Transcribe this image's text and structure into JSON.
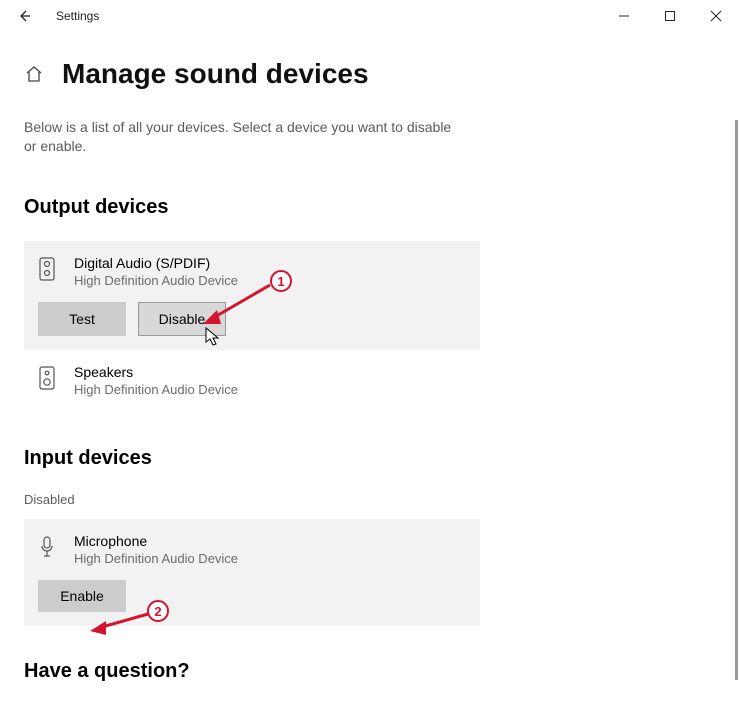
{
  "window": {
    "title": "Settings"
  },
  "page": {
    "title": "Manage sound devices",
    "description": "Below is a list of all your devices. Select a device you want to disable or enable."
  },
  "output": {
    "heading": "Output devices",
    "devices": [
      {
        "name": "Digital Audio (S/PDIF)",
        "sub": "High Definition Audio Device",
        "test_label": "Test",
        "toggle_label": "Disable"
      },
      {
        "name": "Speakers",
        "sub": "High Definition Audio Device"
      }
    ]
  },
  "input": {
    "heading": "Input devices",
    "disabled_label": "Disabled",
    "devices": [
      {
        "name": "Microphone",
        "sub": "High Definition Audio Device",
        "toggle_label": "Enable"
      }
    ]
  },
  "footer": {
    "question_heading": "Have a question?"
  },
  "annotations": {
    "step1": "1",
    "step2": "2"
  }
}
